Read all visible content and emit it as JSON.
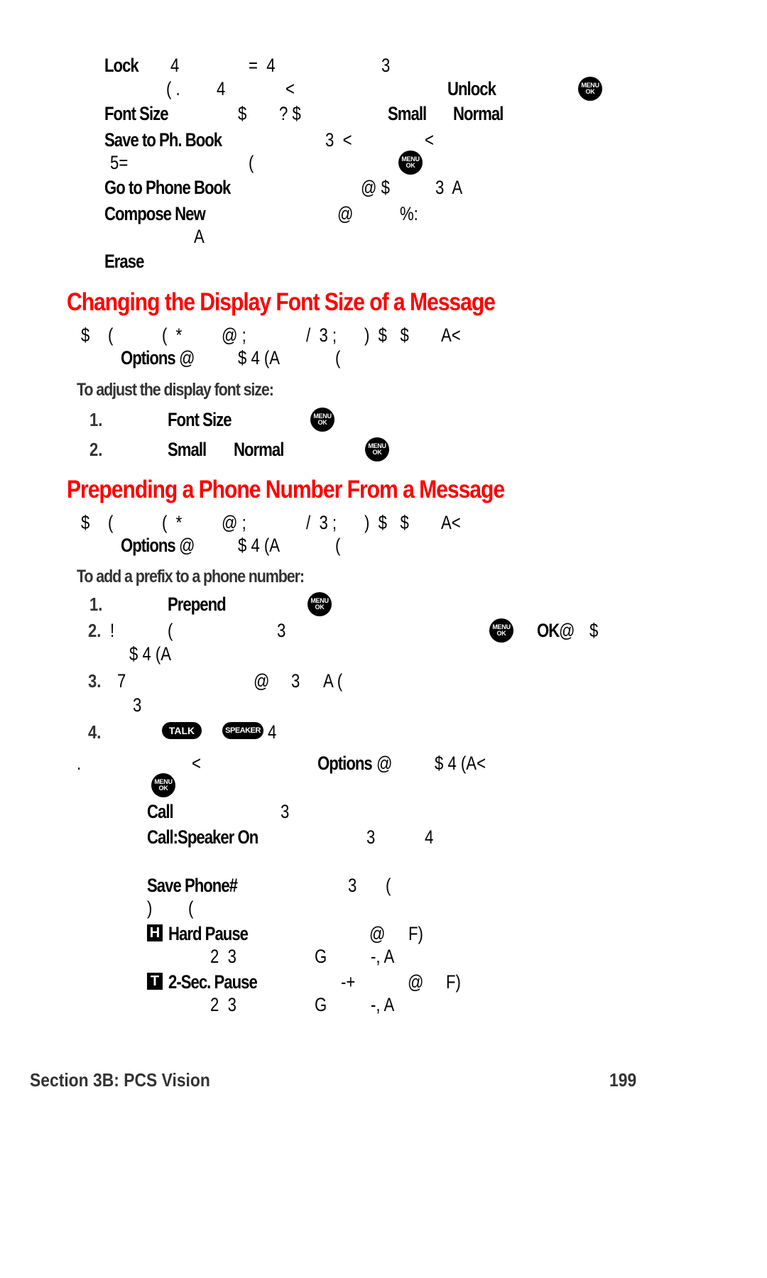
{
  "top_list": {
    "lock": {
      "label": "Lock",
      "frag1": "4",
      "frag2": "=  4",
      "frag3": "3"
    },
    "lock_line2": {
      "frag1": "( .",
      "frag2": "4",
      "frag3": "<",
      "unlock_label": "Unlock"
    },
    "font_size": {
      "label": "Font Size",
      "frag1": "$",
      "frag2": "? $",
      "small": "Small",
      "normal": "Normal"
    },
    "save_to_ph_book": {
      "label": "Save to Ph. Book",
      "frag1": "3  <",
      "frag2": "<"
    },
    "save_line2": {
      "frag1": "5=",
      "frag2": "("
    },
    "go_to_phone_book": {
      "label": "Go to Phone Book",
      "frag1": "@ $",
      "frag2": "3  A"
    },
    "compose_new": {
      "label": "Compose New",
      "frag1": "@",
      "frag2": "%:"
    },
    "compose_line2": {
      "frag1": "A"
    },
    "erase": {
      "label": "Erase"
    }
  },
  "section1": {
    "heading": "Changing the Display Font Size of a Message",
    "intro_line1": [
      "$",
      "(",
      "(  *",
      "@ ;",
      "/  3 ;",
      ")  $   $",
      "A<"
    ],
    "intro_line2": {
      "options_label": "Options",
      "frag1": "@",
      "frag2": "$ 4 (A",
      "frag3": "("
    },
    "subheading": "To adjust the display font size:",
    "steps": [
      {
        "num": "1.",
        "label": "Font Size"
      },
      {
        "num": "2.",
        "label_small": "Small",
        "label_normal": "Normal"
      }
    ]
  },
  "section2": {
    "heading": "Prepending a Phone Number From a Message",
    "intro_line1": [
      "$",
      "(",
      "(  *",
      "@ ;",
      "/  3 ;",
      ")  $   $",
      "A<"
    ],
    "intro_line2": {
      "options_label": "Options",
      "frag1": "@",
      "frag2": "$ 4 (A",
      "frag3": "("
    },
    "subheading": "To add a prefix to a phone number:",
    "steps": [
      {
        "num": "1.",
        "label": "Prepend"
      },
      {
        "num": "2.",
        "frag1": "!",
        "frag2": "(",
        "frag3": "3",
        "ok_label": "OK",
        "frag4": "@",
        "frag5": "$",
        "line2": "$ 4 (A"
      },
      {
        "num": "3.",
        "frag1": "7",
        "frag2": "@",
        "frag3": "3",
        "frag4": "A (",
        "line2": "3"
      },
      {
        "num": "4.",
        "frag1": "4"
      }
    ],
    "note": {
      "frag1": ".",
      "frag2": "<",
      "options_label": "Options",
      "frag3": "@",
      "frag4": "$ 4 (A<"
    },
    "options": [
      {
        "label": "Call",
        "frag1": "3"
      },
      {
        "label": "Call:Speaker On",
        "frag1": "3",
        "frag2": "4"
      },
      {
        "label": "Save Phone#",
        "frag1": "3",
        "frag2": "(",
        "line2_a": ")",
        "line2_b": "("
      },
      {
        "glyph": "H",
        "label": "Hard Pause",
        "frag1": "@",
        "frag2": "F)",
        "line2_a": "2  3",
        "line2_b": "G",
        "line2_c": "-, A"
      },
      {
        "glyph": "T",
        "label": "2-Sec. Pause",
        "frag0": "-+",
        "frag1": "@",
        "frag2": "F)",
        "line2_a": "2  3",
        "line2_b": "G",
        "line2_c": "-, A"
      }
    ]
  },
  "icons": {
    "menu_ok_top": "MENU",
    "menu_ok_bottom": "OK",
    "talk_key": "TALK",
    "speaker_key": "SPEAKER"
  },
  "footer": {
    "section": "Section 3B: PCS Vision",
    "page_number": "199"
  }
}
